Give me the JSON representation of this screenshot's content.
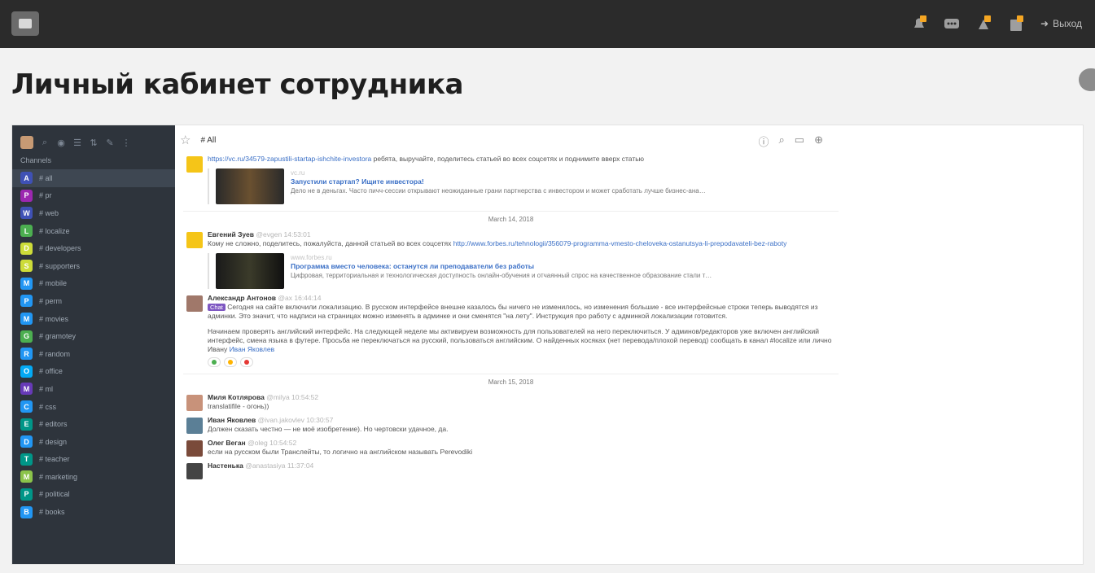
{
  "topbar": {
    "icons": [
      "bell-icon",
      "chat-icon",
      "alert-icon",
      "calendar-icon"
    ],
    "logout_label": "Выход"
  },
  "page": {
    "title": "Личный кабинет сотрудника"
  },
  "sidebar": {
    "section_label": "Channels",
    "channels": [
      {
        "letter": "A",
        "color": "#3f51b5",
        "label": "# all"
      },
      {
        "letter": "P",
        "color": "#9c27b0",
        "label": "# pr"
      },
      {
        "letter": "W",
        "color": "#3f51b5",
        "label": "# web"
      },
      {
        "letter": "L",
        "color": "#4caf50",
        "label": "# localize"
      },
      {
        "letter": "D",
        "color": "#cddc39",
        "label": "# developers"
      },
      {
        "letter": "S",
        "color": "#cddc39",
        "label": "# supporters"
      },
      {
        "letter": "M",
        "color": "#2196f3",
        "label": "# mobile"
      },
      {
        "letter": "P",
        "color": "#2196f3",
        "label": "# perm"
      },
      {
        "letter": "M",
        "color": "#2196f3",
        "label": "# movies"
      },
      {
        "letter": "G",
        "color": "#4caf50",
        "label": "# gramotey"
      },
      {
        "letter": "R",
        "color": "#2196f3",
        "label": "# random"
      },
      {
        "letter": "O",
        "color": "#03a9f4",
        "label": "# office"
      },
      {
        "letter": "M",
        "color": "#673ab7",
        "label": "# ml"
      },
      {
        "letter": "C",
        "color": "#2196f3",
        "label": "# css"
      },
      {
        "letter": "E",
        "color": "#009688",
        "label": "# editors"
      },
      {
        "letter": "D",
        "color": "#2196f3",
        "label": "# design"
      },
      {
        "letter": "T",
        "color": "#009688",
        "label": "# teacher"
      },
      {
        "letter": "M",
        "color": "#8bc34a",
        "label": "# marketing"
      },
      {
        "letter": "P",
        "color": "#009688",
        "label": "# political"
      },
      {
        "letter": "B",
        "color": "#2196f3",
        "label": "# books"
      }
    ]
  },
  "main": {
    "room": "# All",
    "messages": [
      {
        "link": "https://vc.ru/34579-zapustili-startap-ishchite-investora",
        "text": " ребята, выручайте, поделитесь статьей во всех соцсетях и поднимите вверх статью",
        "preview": {
          "site": "vc.ru",
          "title": "Запустили стартап? Ищите инвестора!",
          "desc": "Дело не в деньгах. Часто пичч-сессии открывают неожиданные грани партнерства с инвестором и может сработать лучше бизнес-ана…"
        }
      },
      {
        "author": "Евгений Зуев",
        "handle": "@evgen 14:53:01",
        "text": "Кому не сложно, поделитесь, пожалуйста, данной статьей во всех соцсетях ",
        "link": "http://www.forbes.ru/tehnologii/356079-programma-vmesto-cheloveka-ostanutsya-li-prepodavateli-bez-raboty",
        "preview": {
          "site": "www.forbes.ru",
          "title": "Программа вместо человека: останутся ли преподаватели без работы",
          "desc": "Цифровая, территориальная и технологическая доступность онлайн-обучения и отчаянный спрос на качественное образование стали т…"
        }
      },
      {
        "author": "Александр Антонов",
        "handle": "@ax 16:44:14",
        "tag": "Chat",
        "text": " Сегодня на сайте включили локализацию. В русском интерфейсе внешне казалось бы ничего не изменилось, но изменения большие - все интерфейсные строки теперь выводятся из админки. Это значит, что надписи на страницах можно изменять в админке и они сменятся \"на лету\". Инструкция про работу с админкой локализации готовится.",
        "text2": "Начинаем проверять английский интерфейс. На следующей неделе мы активируем возможность для пользователей на него переключиться. У админов/редакторов уже включен английский интерфейс, смена языка в футере. Просьба не переключаться на русский, пользоваться английским. О найденных косяках (нет перевода/плохой перевод) сообщать в канал #localize или лично Ивану ",
        "mention": "Иван Яковлев"
      }
    ],
    "date1": "March 14, 2018",
    "date2": "March 15, 2018",
    "later": [
      {
        "author": "Миля Котлярова",
        "handle": "@milya 10:54:52",
        "text": "translatifile - огонь))"
      },
      {
        "author": "Иван Яковлев",
        "handle": "@ivan.jakovlev 10:30:57",
        "text": "Должен сказать честно — не моё изобретение). Но чертовски удачное, да."
      },
      {
        "author": "Олег Веган",
        "handle": "@oleg 10:54:52",
        "text": "если на русском были Транслейты, то логично на английском называть Perevodiki"
      },
      {
        "author": "Настенька",
        "handle": "@anastasiya 11:37:04",
        "text": ""
      }
    ]
  },
  "colors": {
    "topbar": "#2b2b2b",
    "sidebar": "#2e343c",
    "accent": "#3a6fc6",
    "tag": "#7e57c2"
  }
}
